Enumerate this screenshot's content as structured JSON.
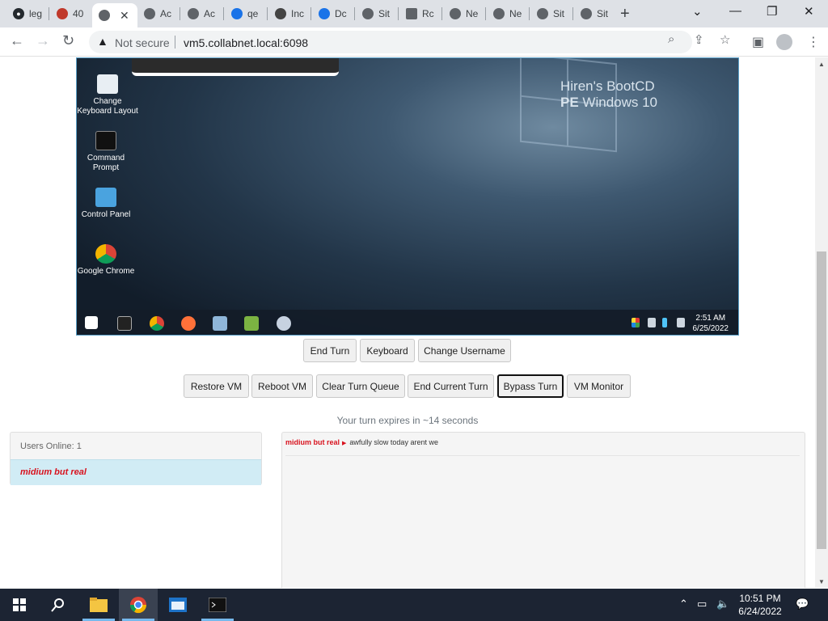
{
  "browser": {
    "tabs": [
      {
        "title": "leg"
      },
      {
        "title": "40"
      },
      {
        "title": ""
      },
      {
        "title": "Ac"
      },
      {
        "title": "Ac"
      },
      {
        "title": "qe"
      },
      {
        "title": "Inc"
      },
      {
        "title": "Dc"
      },
      {
        "title": "Sit"
      },
      {
        "title": "Rc"
      },
      {
        "title": "Ne"
      },
      {
        "title": "Ne"
      },
      {
        "title": "Sit"
      },
      {
        "title": "Sit"
      }
    ],
    "security_label": "Not secure",
    "url": "vm5.collabnet.local:6098"
  },
  "vm": {
    "brand_line1": "Hiren's BootCD",
    "brand_line2_bold": "PE",
    "brand_line2_rest": " Windows 10",
    "desktop_icons": [
      {
        "label_line1": "Change",
        "label_line2": "Keyboard Layout",
        "icon": "keyboard-icon"
      },
      {
        "label_line1": "Command",
        "label_line2": "Prompt",
        "icon": "cmd-icon"
      },
      {
        "label_line1": "Control Panel",
        "label_line2": "",
        "icon": "control-panel-icon"
      },
      {
        "label_line1": "Google Chrome",
        "label_line2": "",
        "icon": "chrome-icon"
      }
    ],
    "clock_time": "2:51 AM",
    "clock_date": "6/25/2022"
  },
  "controls": {
    "row1": [
      "End Turn",
      "Keyboard",
      "Change Username"
    ],
    "row2": [
      "Restore VM",
      "Reboot VM",
      "Clear Turn Queue",
      "End Current Turn",
      "Bypass Turn",
      "VM Monitor"
    ],
    "selected": "Bypass Turn"
  },
  "turn_message": "Your turn expires in ~14 seconds",
  "users": {
    "header": "Users Online: 1",
    "list": [
      "midium but real"
    ]
  },
  "chat": {
    "messages": [
      {
        "user": "midium but real",
        "text": "awfully slow today arent we"
      }
    ]
  },
  "taskbar": {
    "time": "10:51 PM",
    "date": "6/24/2022"
  },
  "colors": {
    "accent_red": "#d8121e",
    "user_row_bg": "#d1ecf5",
    "taskbar_bg": "#1c2433"
  }
}
